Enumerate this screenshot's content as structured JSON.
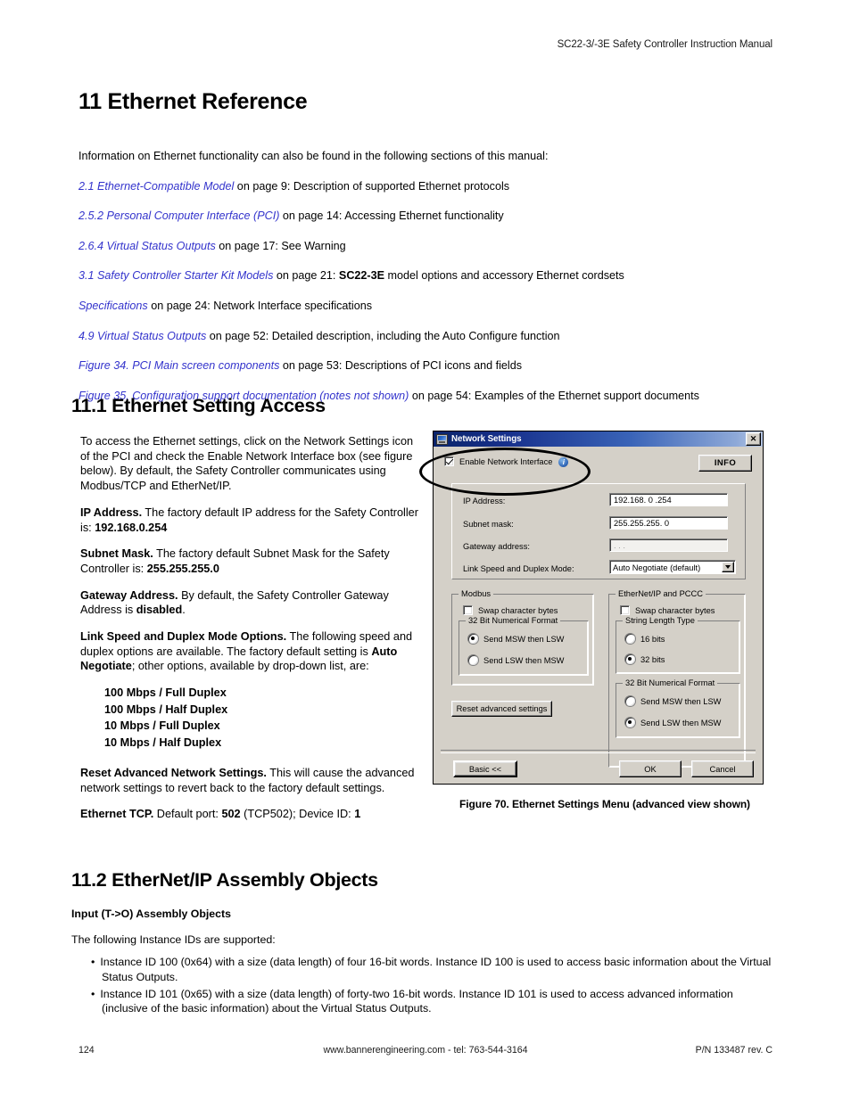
{
  "header": {
    "running_head": "SC22-3/-3E Safety Controller Instruction Manual"
  },
  "chapter": {
    "title": "11 Ethernet Reference",
    "intro": "Information on Ethernet functionality can also be found in the following sections of this manual:",
    "cross_references": [
      {
        "link": "2.1 Ethernet-Compatible Model",
        "rest": " on page 9: Description of supported Ethernet protocols"
      },
      {
        "link": "2.5.2 Personal Computer Interface (PCI)",
        "rest": " on page 14: Accessing Ethernet functionality"
      },
      {
        "link": "2.6.4 Virtual Status Outputs",
        "rest": " on page 17: See Warning"
      },
      {
        "link": "3.1 Safety Controller Starter Kit Models",
        "rest": " on page 21: ",
        "bold": "SC22-3E",
        "tail": " model options and accessory Ethernet cordsets"
      },
      {
        "link": "Specifications",
        "rest": " on page 24: Network Interface specifications"
      },
      {
        "link": "4.9 Virtual Status Outputs",
        "rest": " on page 52: Detailed description, including the Auto Configure function"
      },
      {
        "link": "Figure 34. PCI Main screen components",
        "rest": " on page 53: Descriptions of PCI icons and fields"
      },
      {
        "link": "Figure 35. Configuration support documentation (notes not shown)",
        "rest": " on page 54: Examples of the Ethernet support documents"
      }
    ]
  },
  "section_11_1": {
    "heading": "11.1 Ethernet Setting Access",
    "para_intro": "To access the Ethernet settings, click on the Network Settings icon of the PCI and check the Enable Network Interface box (see figure below). By default, the Safety Controller communicates using Modbus/TCP and EtherNet/IP.",
    "ip_label": "IP Address.",
    "ip_text": " The factory default IP address for the Safety Controller is: ",
    "ip_value": "192.168.0.254",
    "subnet_label": "Subnet Mask.",
    "subnet_text": " The factory default Subnet Mask for the Safety Controller is: ",
    "subnet_value": "255.255.255.0",
    "gateway_label": "Gateway Address.",
    "gateway_text": " By default, the Safety Controller Gateway Address is ",
    "gateway_value": "disabled",
    "gateway_tail": ".",
    "linkspeed_label": "Link Speed and Duplex Mode Options.",
    "linkspeed_text": " The following speed and duplex options are available. The factory default setting is ",
    "linkspeed_default": "Auto Negotiate",
    "linkspeed_tail": "; other options, available by drop-down list, are:",
    "duplex_options": [
      "100 Mbps / Full Duplex",
      "100 Mbps / Half Duplex",
      "10 Mbps / Full Duplex",
      "10 Mbps / Half Duplex"
    ],
    "reset_label": "Reset Advanced Network Settings.",
    "reset_text": " This will cause the advanced network settings to revert back to the factory default settings.",
    "tcp_label": "Ethernet TCP.",
    "tcp_text1": " Default port: ",
    "tcp_port": "502",
    "tcp_text2": " (TCP502); Device ID: ",
    "tcp_device_id": "1"
  },
  "figure": {
    "caption": "Figure 70. Ethernet Settings Menu (advanced view shown)",
    "dialog": {
      "title": "Network Settings",
      "close_label": "✕",
      "enable_checkbox": {
        "label": "Enable Network Interface",
        "checked": true
      },
      "info_icon_label": "i",
      "info_button": "INFO",
      "fields": [
        {
          "label": "IP Address:",
          "value": "192.168.  0 .254",
          "disabled": false
        },
        {
          "label": "Subnet mask:",
          "value": "255.255.255.  0",
          "disabled": false
        },
        {
          "label": "Gateway address:",
          "value": ".     .     .",
          "disabled": true
        }
      ],
      "link_speed": {
        "label": "Link Speed and Duplex Mode:",
        "value": "Auto Negotiate (default)"
      },
      "modbus": {
        "title": "Modbus",
        "swap_bytes": {
          "label": "Swap character bytes",
          "checked": false
        },
        "numeric_format": {
          "title": "32 Bit Numerical Format",
          "options": [
            {
              "label": "Send MSW then LSW",
              "selected": true
            },
            {
              "label": "Send LSW then MSW",
              "selected": false
            }
          ]
        }
      },
      "ethernet_ip": {
        "title": "EtherNet/IP and PCCC",
        "swap_bytes": {
          "label": "Swap character bytes",
          "checked": false
        },
        "string_length": {
          "title": "String Length Type",
          "options": [
            {
              "label": "16 bits",
              "selected": false
            },
            {
              "label": "32 bits",
              "selected": true
            }
          ]
        },
        "numeric_format": {
          "title": "32 Bit Numerical Format",
          "options": [
            {
              "label": "Send MSW then LSW",
              "selected": false
            },
            {
              "label": "Send LSW then MSW",
              "selected": true
            }
          ]
        }
      },
      "reset_button": "Reset advanced settings",
      "basic_button": "Basic <<",
      "ok_button": "OK",
      "cancel_button": "Cancel"
    }
  },
  "section_11_2": {
    "heading": "11.2 EtherNet/IP Assembly Objects",
    "subhead": "Input (T->O) Assembly Objects",
    "lead": "The following Instance IDs are supported:",
    "bullets": [
      "Instance ID 100 (0x64) with a size (data length) of four 16-bit words. Instance ID 100 is used to access basic information about the Virtual Status Outputs.",
      "Instance ID 101 (0x65) with a size (data length) of forty-two 16-bit words. Instance ID 101 is used to access advanced information (inclusive of the basic information) about the Virtual Status Outputs."
    ]
  },
  "footer": {
    "page_number": "124",
    "center": "www.bannerengineering.com - tel: 763-544-3164",
    "right": "P/N 133487 rev. C"
  }
}
